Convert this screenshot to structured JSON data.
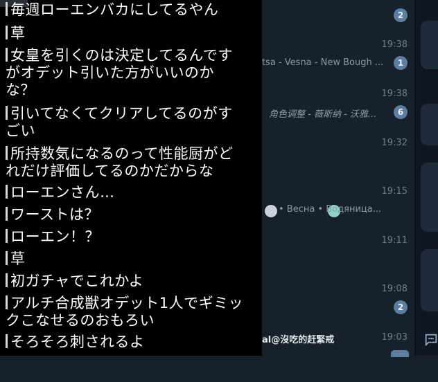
{
  "chatlist": {
    "rows": [
      {
        "time": "",
        "preview": "",
        "badge": "2"
      },
      {
        "time": "19:38",
        "preview": "tsa - Vesna - New Bough ...",
        "badge": "1"
      },
      {
        "time": "19:38",
        "preview": "角色调整 - 薇斯纳 - 沃雅...",
        "badge": "6"
      },
      {
        "time": "19:32",
        "preview": "",
        "badge": ""
      },
      {
        "time": "19:15",
        "preview": "• Весна • Водяница...",
        "badge": ""
      },
      {
        "time": "19:11",
        "preview": "",
        "badge": ""
      },
      {
        "time": "19:08",
        "preview": "",
        "badge": "2"
      },
      {
        "time": "19:03",
        "preview": "",
        "badge": "",
        "name": "al@沒吃的赶緊戒"
      }
    ]
  },
  "comments": [
    {
      "text": "毎週ローエンバカにしてるやん"
    },
    {
      "text": "草"
    },
    {
      "text": "女皇を引くのは決定してるんです\nがオデット引いた方がいいのか\nな？"
    },
    {
      "text": "引いてなくてクリアしてるのがす\nごい"
    },
    {
      "text": "所持数気になるのって性能厨がど\nれだけ評価してるのかだからな"
    },
    {
      "text": "ローエンさん…"
    },
    {
      "text": "ワーストは？"
    },
    {
      "text": "ローエン！？"
    },
    {
      "text": "草"
    },
    {
      "text": "初ガチャでこれかよ"
    },
    {
      "text": "アルチ合成獣オデット1人でギミッ\nクこなせるのおもろい"
    },
    {
      "text": "そろそろ刺されるよ"
    }
  ],
  "colors": {
    "badge": "#5e7ea0",
    "panel": "#17212b",
    "overlay": "#000000"
  }
}
